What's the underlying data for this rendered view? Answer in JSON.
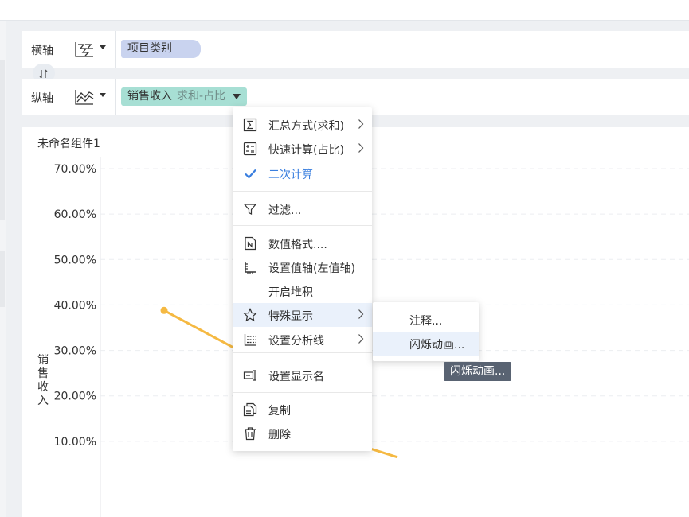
{
  "axes": {
    "x_label": "横轴",
    "y_label": "纵轴",
    "x_field": "项目类别",
    "y_field": "销售收入",
    "y_field_agg": "求和-占比"
  },
  "widget": {
    "title": "未命名组件1",
    "y_axis_title": "销售收入"
  },
  "chart_data": {
    "type": "line",
    "ylabel": "销售收入",
    "y_ticks": [
      "70.00%",
      "60.00%",
      "50.00%",
      "40.00%",
      "30.00%",
      "20.00%",
      "10.00%"
    ],
    "ylim": [
      0,
      0.7
    ],
    "series": [
      {
        "values": [
          0.388,
          0.235,
          0.085,
          0.065
        ]
      }
    ],
    "color": "#f5b942",
    "grid": true
  },
  "context_menu": {
    "items": [
      {
        "label": "汇总方式(求和)",
        "icon": "sigma-icon",
        "submenu": true
      },
      {
        "label": "快速计算(占比)",
        "icon": "calculator-icon",
        "submenu": true
      },
      {
        "label": "二次计算",
        "icon": "check-icon",
        "checked": true
      },
      {
        "label": "过滤...",
        "icon": "filter-icon"
      },
      {
        "label": "数值格式....",
        "icon": "number-format-icon"
      },
      {
        "label": "设置值轴(左值轴)",
        "icon": "value-axis-icon"
      },
      {
        "label": "开启堆积",
        "icon": ""
      },
      {
        "label": "特殊显示",
        "icon": "star-icon",
        "submenu": true
      },
      {
        "label": "设置分析线",
        "icon": "analysis-line-icon",
        "submenu": true
      },
      {
        "label": "设置显示名",
        "icon": "rename-icon"
      },
      {
        "label": "复制",
        "icon": "copy-icon"
      },
      {
        "label": "删除",
        "icon": "trash-icon"
      }
    ]
  },
  "submenu": {
    "items": [
      {
        "label": "注释..."
      },
      {
        "label": "闪烁动画..."
      }
    ]
  },
  "tooltip": {
    "text": "闪烁动画..."
  },
  "colors": {
    "accent": "#3a7fdf",
    "category_pill": "#c9d3ef",
    "value_pill": "#a7dfd4",
    "line": "#f5b942",
    "tooltip_bg": "#596372"
  }
}
